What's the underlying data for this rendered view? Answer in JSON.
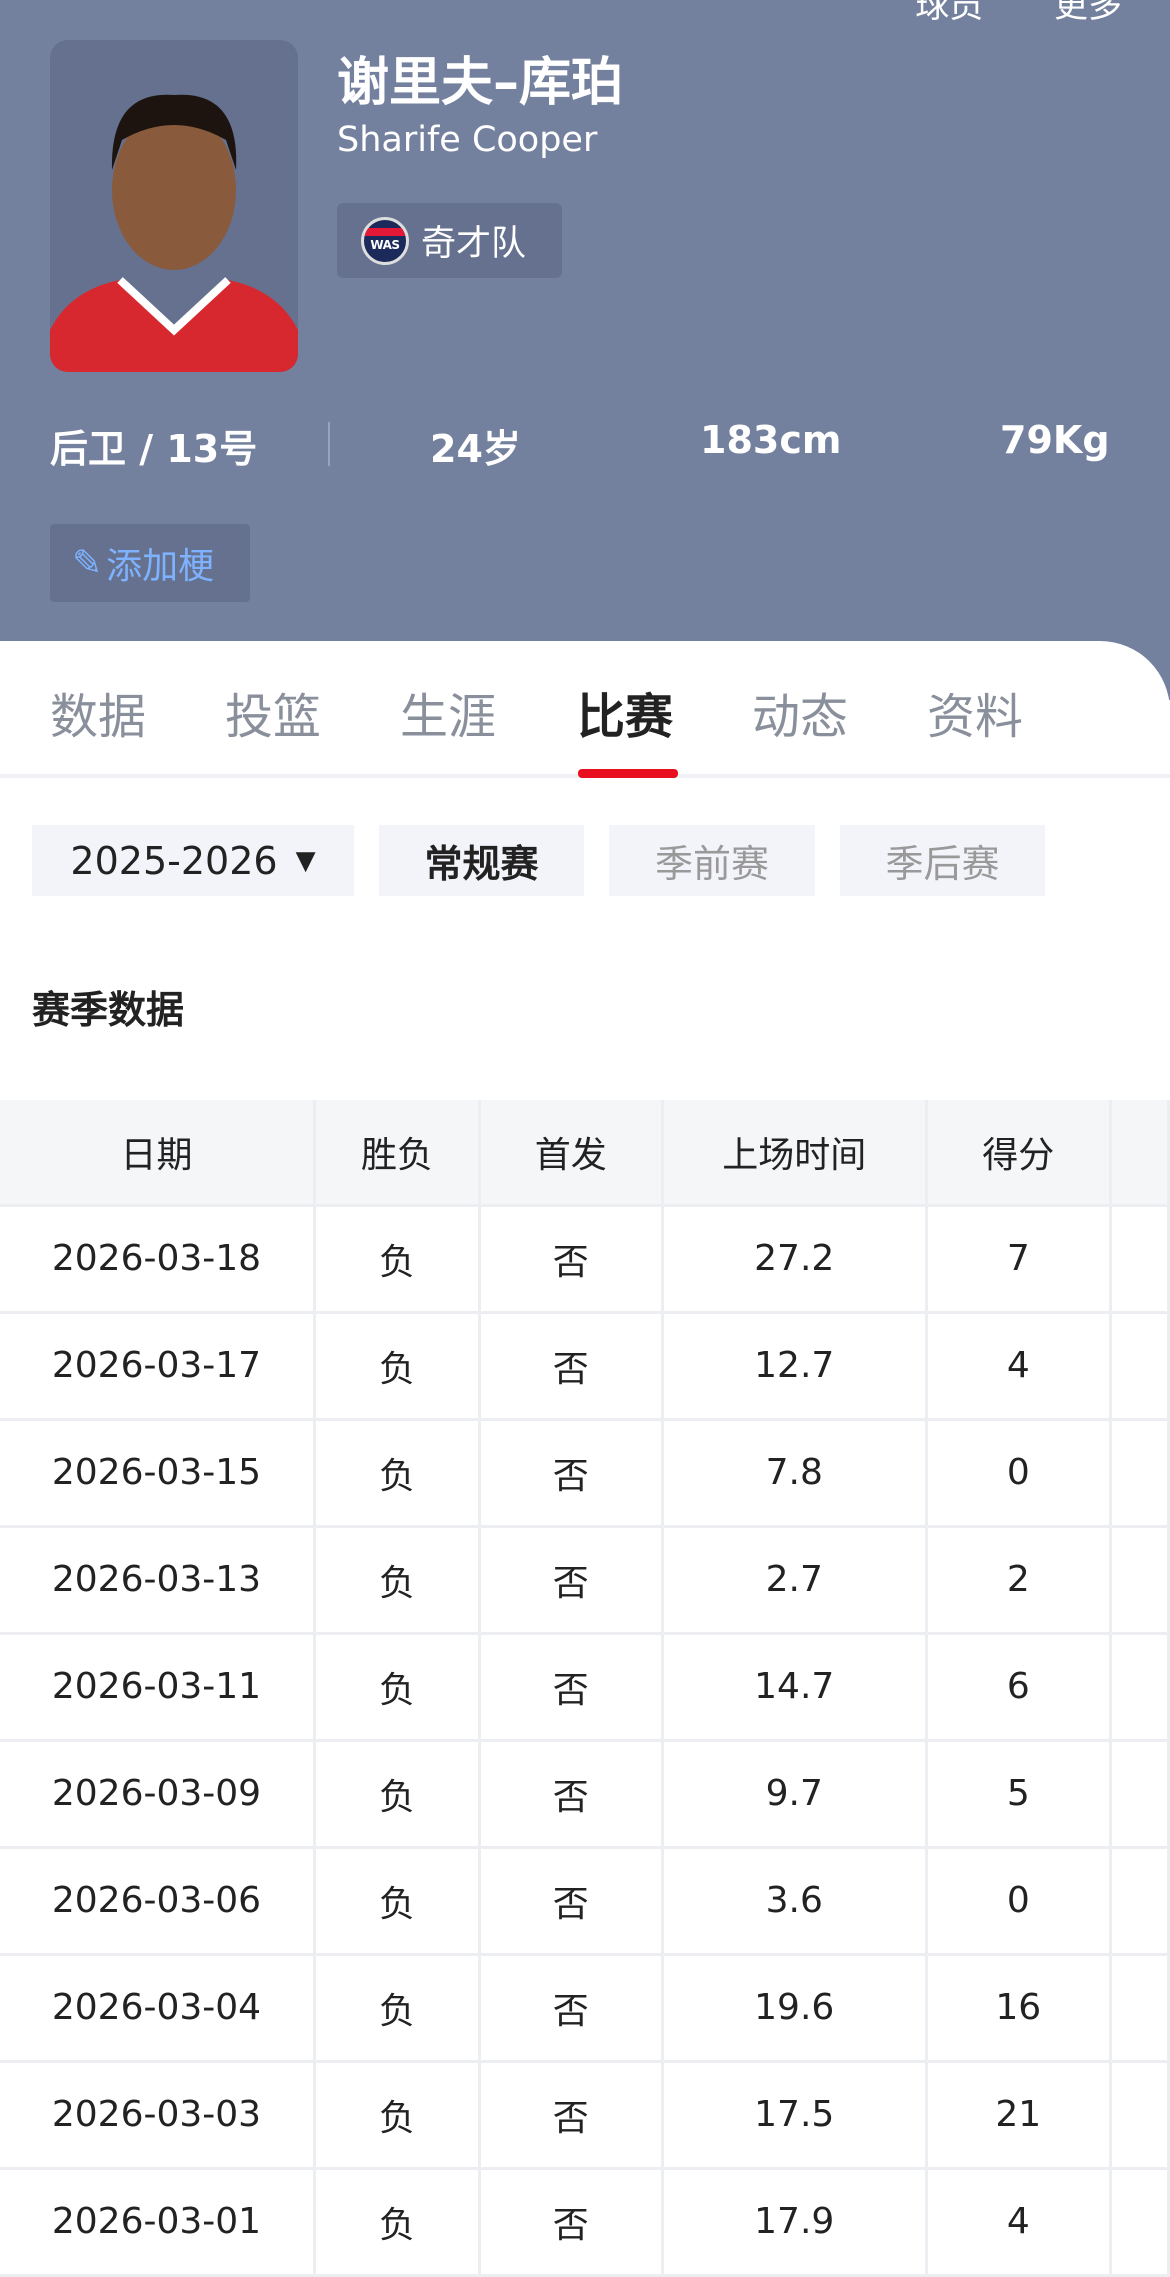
{
  "topnav": {
    "players": "球员",
    "more": "更多"
  },
  "player": {
    "name_cn": "谢里夫–库珀",
    "name_en": "Sharife Cooper",
    "team": "奇才队",
    "team_logo_text": "WAS",
    "position_number": "后卫 / 13号",
    "age": "24岁",
    "height": "183cm",
    "weight": "79Kg",
    "add_label": "添加梗"
  },
  "tabs": [
    {
      "label": "数据"
    },
    {
      "label": "投篮"
    },
    {
      "label": "生涯"
    },
    {
      "label": "比赛"
    },
    {
      "label": "动态"
    },
    {
      "label": "资料"
    }
  ],
  "filters": {
    "season": "2025-2026",
    "types": [
      "常规赛",
      "季前赛",
      "季后赛"
    ]
  },
  "section_title": "赛季数据",
  "table": {
    "headers": [
      "日期",
      "胜负",
      "首发",
      "上场时间",
      "得分"
    ],
    "rows": [
      [
        "2026-03-18",
        "负",
        "否",
        "27.2",
        "7"
      ],
      [
        "2026-03-17",
        "负",
        "否",
        "12.7",
        "4"
      ],
      [
        "2026-03-15",
        "负",
        "否",
        "7.8",
        "0"
      ],
      [
        "2026-03-13",
        "负",
        "否",
        "2.7",
        "2"
      ],
      [
        "2026-03-11",
        "负",
        "否",
        "14.7",
        "6"
      ],
      [
        "2026-03-09",
        "负",
        "否",
        "9.7",
        "5"
      ],
      [
        "2026-03-06",
        "负",
        "否",
        "3.6",
        "0"
      ],
      [
        "2026-03-04",
        "负",
        "否",
        "19.6",
        "16"
      ],
      [
        "2026-03-03",
        "负",
        "否",
        "17.5",
        "21"
      ],
      [
        "2026-03-01",
        "负",
        "否",
        "17.9",
        "4"
      ]
    ]
  }
}
